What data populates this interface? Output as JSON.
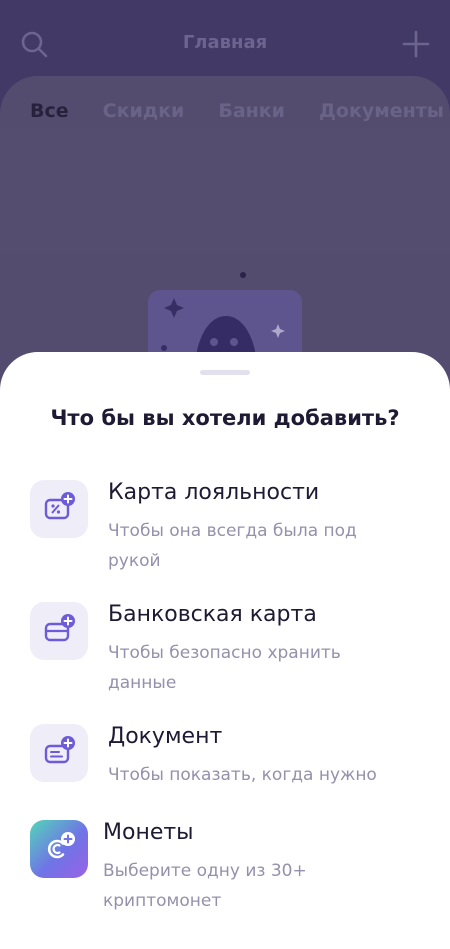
{
  "header": {
    "title": "Главная",
    "search_icon": "search-icon",
    "add_icon": "plus-icon"
  },
  "tabs": [
    {
      "label": "Все",
      "active": true
    },
    {
      "label": "Скидки",
      "active": false
    },
    {
      "label": "Банки",
      "active": false
    },
    {
      "label": "Документы",
      "active": false
    }
  ],
  "sheet": {
    "title": "Что бы вы хотели добавить?",
    "options": [
      {
        "label": "Карта лояльности",
        "subtitle": "Чтобы она всегда была под рукой",
        "icon": "loyalty-card-add-icon"
      },
      {
        "label": "Банковская карта",
        "subtitle": "Чтобы безопасно хранить данные",
        "icon": "bank-card-add-icon"
      },
      {
        "label": "Документ",
        "subtitle": "Чтобы показать, когда нужно",
        "icon": "document-add-icon"
      },
      {
        "label": "Монеты",
        "subtitle": "Выберите одну из 30+ криптомонет",
        "icon": "crypto-coin-add-icon"
      }
    ]
  },
  "colors": {
    "accent": "#6d5bd8",
    "sheet_bg": "#ffffff",
    "icon_bg": "#efedf8",
    "background_dim": "#4a4171"
  }
}
